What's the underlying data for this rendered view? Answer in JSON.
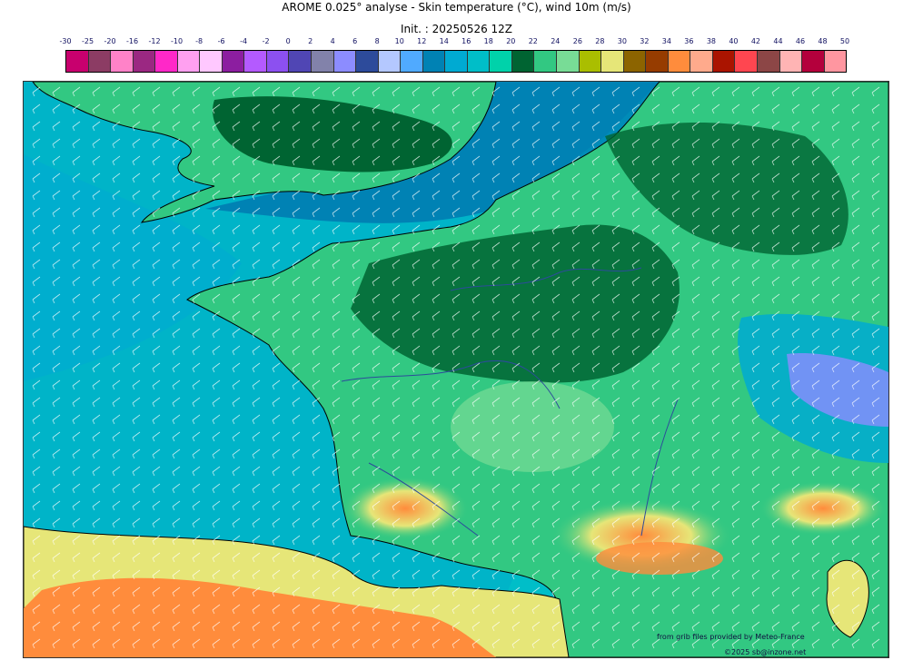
{
  "title": {
    "line1": "AROME 0.025° analyse - Skin temperature (°C), wind 10m (m/s)",
    "line2": "Init. : 20250526 12Z"
  },
  "legend": {
    "labels": [
      "-30",
      "-25",
      "-20",
      "-16",
      "-12",
      "-10",
      "-8",
      "-6",
      "-4",
      "-2",
      "0",
      "2",
      "4",
      "6",
      "8",
      "10",
      "12",
      "14",
      "16",
      "18",
      "20",
      "22",
      "24",
      "26",
      "28",
      "30",
      "32",
      "34",
      "36",
      "38",
      "40",
      "42",
      "44",
      "46",
      "48",
      "50"
    ],
    "colors": [
      "#c8006e",
      "#8c3c64",
      "#ff82c8",
      "#9b2882",
      "#ff28c8",
      "#ffa0f0",
      "#ffc8ff",
      "#8c1ea0",
      "#b45aff",
      "#8c50f0",
      "#5046b4",
      "#8282aa",
      "#8c8cff",
      "#2d4b9b",
      "#b4c8ff",
      "#50aaff",
      "#0082b4",
      "#00aad2",
      "#00bec8",
      "#00d2aa",
      "#006432",
      "#32c882",
      "#78dc96",
      "#aabe00",
      "#e6e678",
      "#8c6400",
      "#963c00",
      "#ff8c3c",
      "#ffaa8c",
      "#aa1400",
      "#ff4650",
      "#8c4646",
      "#ffb4b4",
      "#b4003c",
      "#ff96a0"
    ]
  },
  "map": {
    "description_colors": {
      "sea": "#00b4c8",
      "sea_deep": "#0082b4",
      "land_warm": "#32c882",
      "land_cool": "#006432",
      "hot": "#e6e678",
      "very_hot": "#ff8c3c",
      "coast": "#000000",
      "rivers": "#2d4b9b",
      "wind_barbs": "#ffffff"
    }
  },
  "credits": {
    "source": "from grib files provided by Meteo-France",
    "copyright": "©2025 sb@inzone.net"
  }
}
